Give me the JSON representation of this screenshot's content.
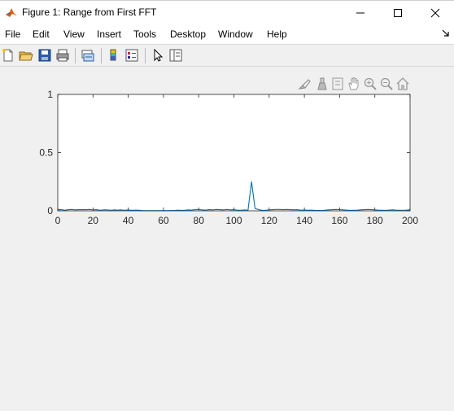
{
  "window": {
    "title": "Figure 1: Range from First FFT"
  },
  "menubar": {
    "items": [
      {
        "label": "File"
      },
      {
        "label": "Edit"
      },
      {
        "label": "View"
      },
      {
        "label": "Insert"
      },
      {
        "label": "Tools"
      },
      {
        "label": "Desktop"
      },
      {
        "label": "Window"
      },
      {
        "label": "Help"
      }
    ]
  },
  "toolbar": {
    "buttons": [
      "new-figure-icon",
      "open-file-icon",
      "save-icon",
      "print-icon",
      "link-plot-icon",
      "colorbar-icon",
      "legend-icon",
      "edit-plot-icon",
      "property-inspector-icon"
    ]
  },
  "axes_toolbar": {
    "buttons": [
      "brush-icon",
      "data-cursor-icon",
      "datatip-icon",
      "pan-icon",
      "zoom-in-icon",
      "zoom-out-icon",
      "home-icon"
    ]
  },
  "colors": {
    "line": "#0072bd",
    "axes_bg": "#ffffff",
    "figure_bg": "#f0f0f0"
  },
  "chart_data": {
    "type": "line",
    "xlim": [
      0,
      200
    ],
    "ylim": [
      0,
      1
    ],
    "xticks": [
      0,
      20,
      40,
      60,
      80,
      100,
      120,
      140,
      160,
      180,
      200
    ],
    "yticks": [
      0,
      0.5,
      1
    ],
    "xtick_labels": [
      "0",
      "20",
      "40",
      "60",
      "80",
      "100",
      "120",
      "140",
      "160",
      "180",
      "200"
    ],
    "ytick_labels": [
      "0",
      "0.5",
      "1"
    ],
    "grid": false,
    "series": [
      {
        "x": [
          0,
          2,
          4,
          6,
          8,
          10,
          12,
          14,
          16,
          18,
          20,
          22,
          24,
          26,
          28,
          30,
          32,
          34,
          36,
          38,
          40,
          42,
          44,
          46,
          48,
          50,
          52,
          54,
          56,
          58,
          60,
          62,
          64,
          66,
          68,
          70,
          72,
          74,
          76,
          78,
          80,
          82,
          84,
          86,
          88,
          90,
          92,
          94,
          96,
          98,
          100,
          102,
          104,
          106,
          108,
          110,
          112,
          114,
          116,
          118,
          120,
          122,
          124,
          126,
          128,
          130,
          132,
          134,
          136,
          138,
          140,
          142,
          144,
          146,
          148,
          150,
          152,
          154,
          156,
          158,
          160,
          162,
          164,
          166,
          168,
          170,
          172,
          174,
          176,
          178,
          180,
          182,
          184,
          186,
          188,
          190,
          192,
          194,
          196,
          198,
          200
        ],
        "y": [
          0.01,
          0.01,
          0.005,
          0.01,
          0.012,
          0.008,
          0.01,
          0.01,
          0.01,
          0.012,
          0.008,
          0.01,
          0.005,
          0.008,
          0.008,
          0.005,
          0.008,
          0.006,
          0.008,
          0.005,
          0.008,
          0.004,
          0.006,
          0.005,
          0.002,
          0.001,
          0.001,
          0.001,
          0.001,
          0.001,
          0.002,
          0.001,
          0.002,
          0.002,
          0.006,
          0.004,
          0.005,
          0.008,
          0.006,
          0.01,
          0.012,
          0.008,
          0.006,
          0.01,
          0.008,
          0.012,
          0.01,
          0.008,
          0.012,
          0.008,
          0.01,
          0.006,
          0.005,
          0.008,
          0.005,
          0.25,
          0.02,
          0.01,
          0.004,
          0.005,
          0.008,
          0.01,
          0.012,
          0.012,
          0.01,
          0.012,
          0.01,
          0.008,
          0.01,
          0.005,
          0.008,
          0.005,
          0.006,
          0.004,
          0.003,
          0.002,
          0.006,
          0.008,
          0.01,
          0.012,
          0.01,
          0.008,
          0.006,
          0.004,
          0.005,
          0.006,
          0.008,
          0.01,
          0.012,
          0.01,
          0.008,
          0.006,
          0.005,
          0.004,
          0.006,
          0.008,
          0.006,
          0.005,
          0.004,
          0.006,
          0.008
        ]
      }
    ]
  }
}
